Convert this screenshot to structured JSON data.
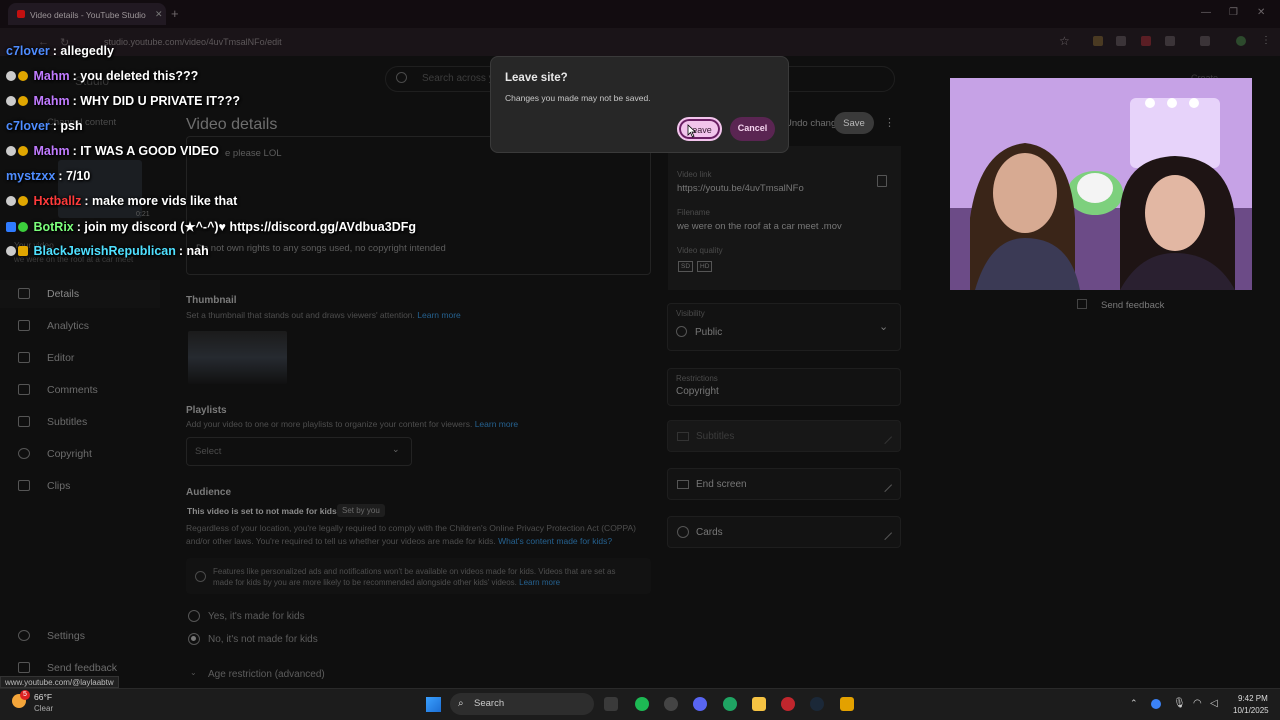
{
  "browser": {
    "tab_title": "Video details - YouTube Studio",
    "url": "studio.youtube.com/video/4uvTmsalNFo/edit",
    "status_url": "www.youtube.com/@laylaabtw"
  },
  "studio": {
    "logo_text": "Studio",
    "search_placeholder": "Search across y",
    "create_label": "Create",
    "page_title": "Video details",
    "undo_label": "Undo changes",
    "save_label": "Save",
    "channel_content": "Channel content",
    "your_video": "Your video",
    "video_subtitle": "we were on the roof at a car meet",
    "video_duration": "0:21",
    "description_frag": "e please LOL",
    "description_line2": "Do not own rights to any songs used, no copyright intended",
    "sidebar": [
      {
        "label": "Details",
        "icon": "pencil-icon"
      },
      {
        "label": "Analytics",
        "icon": "chart-icon"
      },
      {
        "label": "Editor",
        "icon": "film-icon"
      },
      {
        "label": "Comments",
        "icon": "comment-icon"
      },
      {
        "label": "Subtitles",
        "icon": "subtitles-icon"
      },
      {
        "label": "Copyright",
        "icon": "copyright-icon"
      },
      {
        "label": "Clips",
        "icon": "scissors-icon"
      }
    ],
    "settings_label": "Settings",
    "feedback_label": "Send feedback",
    "thumbnail": {
      "title": "Thumbnail",
      "sub": "Set a thumbnail that stands out and draws viewers' attention.",
      "learn": "Learn more"
    },
    "playlists": {
      "title": "Playlists",
      "sub": "Add your video to one or more playlists to organize your content for viewers.",
      "learn": "Learn more",
      "select": "Select"
    },
    "audience": {
      "title": "Audience",
      "status": "This video is set to not made for kids",
      "chip": "Set by you",
      "body1": "Regardless of your location, you're legally required to comply with the Children's Online Privacy Protection Act (COPPA)",
      "body2": "and/or other laws. You're required to tell us whether your videos are made for kids.",
      "body_link": "What's content made for kids?",
      "note1": "Features like personalized ads and notifications won't be available on videos made for kids. Videos that are set as",
      "note2": "made for kids by you are more likely to be recommended alongside other kids' videos.",
      "note_link": "Learn more",
      "opt_yes": "Yes, it's made for kids",
      "opt_no": "No, it's not made for kids",
      "age_restriction": "Age restriction (advanced)"
    },
    "right": {
      "video_link_label": "Video link",
      "video_link": "https://youtu.be/4uvTmsalNFo",
      "filename_label": "Filename",
      "filename": "we were on the roof at a car meet .mov",
      "quality_label": "Video quality",
      "quality_sd": "SD",
      "quality_hd": "HD",
      "visibility_label": "Visibility",
      "visibility_value": "Public",
      "restrictions_label": "Restrictions",
      "restrictions_value": "Copyright",
      "subtitles": "Subtitles",
      "end_screen": "End screen",
      "cards": "Cards",
      "send_feedback": "Send feedback"
    }
  },
  "dialog": {
    "title": "Leave site?",
    "message": "Changes you made may not be saved.",
    "leave": "Leave",
    "cancel": "Cancel"
  },
  "chat": [
    {
      "user": "c7lover",
      "msg": ": allegedly",
      "color": "#4f8dff",
      "badges": []
    },
    {
      "user": "Mahm",
      "msg": ": you deleted this???",
      "color": "#c07bff",
      "badges": [
        "mod",
        "gold"
      ]
    },
    {
      "user": "Mahm",
      "msg": ": WHY DID U PRIVATE IT???",
      "color": "#c07bff",
      "badges": [
        "mod",
        "gold"
      ]
    },
    {
      "user": "c7lover",
      "msg": ": psh",
      "color": "#4f8dff",
      "badges": []
    },
    {
      "user": "Mahm",
      "msg": ": IT WAS A GOOD VIDEO",
      "color": "#c07bff",
      "badges": [
        "mod",
        "gold"
      ]
    },
    {
      "user": "mystzxx",
      "msg": ": 7/10",
      "color": "#4f8dff",
      "badges": []
    },
    {
      "user": "Hxtballz",
      "msg": ": make more vids like that",
      "color": "#ff3b3b",
      "badges": [
        "mod",
        "gold"
      ]
    },
    {
      "user": "BotRix",
      "msg": ": join my discord (★^-^)♥ https://discord.gg/AVdbua3DFg",
      "color": "#7cff7c",
      "badges": [
        "bot",
        "check"
      ]
    },
    {
      "user": "BlackJewishRepublican",
      "msg": ": nah",
      "color": "#4fe0ff",
      "badges": [
        "mod",
        "gift"
      ]
    }
  ],
  "taskbar": {
    "weather_temp": "66°F",
    "weather_desc": "Clear",
    "weather_badge": "5",
    "search": "Search",
    "time": "9:42 PM",
    "date": "10/1/2025"
  }
}
